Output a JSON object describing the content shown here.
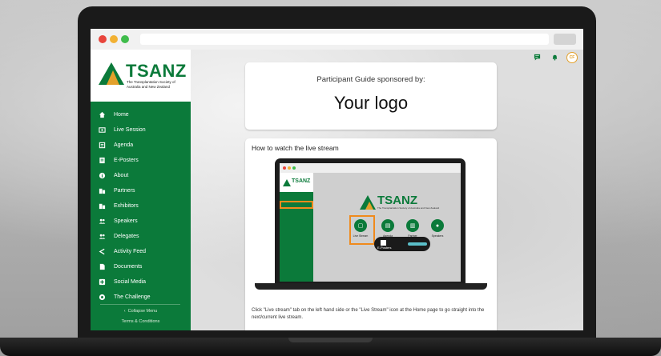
{
  "window": {
    "traffic_lights": [
      "#e8453c",
      "#f2b133",
      "#3fbc4b"
    ]
  },
  "sidebar": {
    "brand": {
      "title": "TSANZ",
      "subtitle": "The Transplantation Society of Australia and New Zealand"
    },
    "items": [
      {
        "label": "Home",
        "icon": "home-icon"
      },
      {
        "label": "Live Session",
        "icon": "live-session-icon"
      },
      {
        "label": "Agenda",
        "icon": "agenda-icon"
      },
      {
        "label": "E-Posters",
        "icon": "eposters-icon"
      },
      {
        "label": "About",
        "icon": "info-icon"
      },
      {
        "label": "Partners",
        "icon": "partners-icon"
      },
      {
        "label": "Exhibitors",
        "icon": "exhibitors-icon"
      },
      {
        "label": "Speakers",
        "icon": "speakers-icon"
      },
      {
        "label": "Delegates",
        "icon": "delegates-icon"
      },
      {
        "label": "Activity Feed",
        "icon": "share-icon"
      },
      {
        "label": "Documents",
        "icon": "document-icon"
      },
      {
        "label": "Social Media",
        "icon": "social-icon"
      },
      {
        "label": "The Challenge",
        "icon": "challenge-icon"
      }
    ],
    "collapse_label": "Collapse Menu",
    "collapse_icon": "chevron-left-icon",
    "terms_label": "Terms & Conditions"
  },
  "header": {
    "icons": [
      "chat-icon",
      "bell-icon",
      "avatar"
    ],
    "avatar_initials": "CF"
  },
  "main": {
    "sponsor_card": {
      "heading": "Participant Guide sponsored by:",
      "logo_text": "Your logo"
    },
    "guide_card": {
      "title": "How to watch the live stream",
      "caption": "Click \"Live stream\" tab on the left hand side or the \"Live Stream\" icon at the Home page to go straight into the next/current live stream.",
      "illustration": {
        "brand_title": "TSANZ",
        "brand_subtitle": "The Transplantation Society of Australia and New Zealand",
        "home_icons": [
          {
            "label": "Live Stream",
            "icon": "live-stream-icon"
          },
          {
            "label": "Agenda",
            "icon": "agenda-icon"
          },
          {
            "label": "Partner",
            "icon": "partners-icon"
          },
          {
            "label": "Speakers",
            "icon": "speakers-icon"
          }
        ],
        "pill_label": "E-Posters"
      }
    }
  },
  "colors": {
    "brand_green": "#0b7a3a",
    "highlight_orange": "#f08a1c",
    "logo_gold": "#e3a12b"
  }
}
